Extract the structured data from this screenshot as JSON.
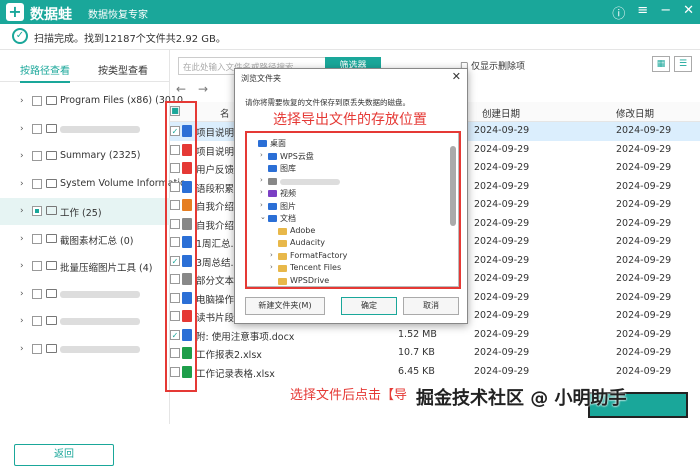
{
  "app": {
    "name": "数据蛙",
    "subtitle": "数据恢复专家"
  },
  "status": {
    "text": "扫描完成。找到12187个文件共2.92 GB。"
  },
  "tabs": [
    "按路径查看",
    "按类型查看"
  ],
  "tree": [
    {
      "label": "Program Files (x86) (3010",
      "blur": false
    },
    {
      "label": "",
      "blur": true
    },
    {
      "label": "Summary (2325)",
      "blur": false
    },
    {
      "label": "System Volume Informatio",
      "blur": false
    },
    {
      "label": "工作 (25)",
      "blur": false,
      "selected": true
    },
    {
      "label": "截图素材汇总 (0)",
      "blur": false
    },
    {
      "label": "批量压缩图片工具 (4)",
      "blur": false
    },
    {
      "label": "",
      "blur": true
    },
    {
      "label": "",
      "blur": true
    },
    {
      "label": "",
      "blur": true
    }
  ],
  "back_label": "返回",
  "toolbar": {
    "search_placeholder": "在此处输入文件名或路径搜索",
    "filter_label": "筛选器",
    "delete_only_label": "仅显示删除项"
  },
  "columns": {
    "name": "名",
    "created": "创建日期",
    "modified": "修改日期"
  },
  "rows": [
    {
      "name": "项目说明书",
      "size": "",
      "created": "2024-09-29",
      "modified": "2024-09-29",
      "checked": true,
      "color": "#2b6fd6",
      "selected": true
    },
    {
      "name": "项目说明书",
      "size": "",
      "created": "2024-09-29",
      "modified": "2024-09-29",
      "checked": false,
      "color": "#e53935"
    },
    {
      "name": "用户反馈数",
      "size": "",
      "created": "2024-09-29",
      "modified": "2024-09-29",
      "checked": false,
      "color": "#e53935"
    },
    {
      "name": "语段积累.do",
      "size": "",
      "created": "2024-09-29",
      "modified": "2024-09-29",
      "checked": false,
      "color": "#2b6fd6"
    },
    {
      "name": "自我介绍.ppt",
      "size": "",
      "created": "2024-09-29",
      "modified": "2024-09-29",
      "checked": false,
      "color": "#e67e22"
    },
    {
      "name": "自我介绍.txt",
      "size": "",
      "created": "2024-09-29",
      "modified": "2024-09-29",
      "checked": false,
      "color": "#888"
    },
    {
      "name": "1周汇总.doc",
      "size": "",
      "created": "2024-09-29",
      "modified": "2024-09-29",
      "checked": false,
      "color": "#2b6fd6"
    },
    {
      "name": "3周总结.doc",
      "size": "",
      "created": "2024-09-29",
      "modified": "2024-09-29",
      "checked": true,
      "color": "#2b6fd6"
    },
    {
      "name": "部分文本框",
      "size": "",
      "created": "2024-09-29",
      "modified": "2024-09-29",
      "checked": false,
      "color": "#888"
    },
    {
      "name": "电脑操作说",
      "size": "",
      "created": "2024-09-29",
      "modified": "2024-09-29",
      "checked": false,
      "color": "#2b6fd6"
    },
    {
      "name": "读书片段记录.pptx",
      "size": "",
      "created": "2024-09-29",
      "modified": "2024-09-29",
      "checked": false,
      "color": "#e53935"
    },
    {
      "name": "附: 使用注意事项.docx",
      "size": "1.52 MB",
      "created": "2024-09-29",
      "modified": "2024-09-29",
      "checked": true,
      "color": "#2b6fd6"
    },
    {
      "name": "工作报表2.xlsx",
      "size": "10.7 KB",
      "created": "2024-09-29",
      "modified": "2024-09-29",
      "checked": false,
      "color": "#1e9e4a"
    },
    {
      "name": "工作记录表格.xlsx",
      "size": "6.45 KB",
      "created": "2024-09-29",
      "modified": "2024-09-29",
      "checked": false,
      "color": "#1e9e4a"
    }
  ],
  "dialog": {
    "title": "浏览文件夹",
    "message": "请你将需要恢复的文件保存到原丢失数据的磁盘。",
    "annotation": "选择导出文件的存放位置",
    "nodes": [
      {
        "label": "桌面",
        "indent": 0,
        "arrow": "",
        "color": "#2b6fd6"
      },
      {
        "label": "WPS云盘",
        "indent": 1,
        "arrow": "›",
        "color": "#2b6fd6"
      },
      {
        "label": "图库",
        "indent": 1,
        "arrow": "",
        "color": "#2b6fd6"
      },
      {
        "label": "",
        "indent": 1,
        "arrow": "›",
        "color": "#888",
        "blur": true
      },
      {
        "label": "视频",
        "indent": 1,
        "arrow": "›",
        "color": "#7b3fc4"
      },
      {
        "label": "图片",
        "indent": 1,
        "arrow": "›",
        "color": "#2b6fd6"
      },
      {
        "label": "文档",
        "indent": 1,
        "arrow": "⌄",
        "color": "#2b6fd6"
      },
      {
        "label": "Adobe",
        "indent": 2,
        "arrow": "",
        "color": "#e8b84a"
      },
      {
        "label": "Audacity",
        "indent": 2,
        "arrow": "",
        "color": "#e8b84a"
      },
      {
        "label": "FormatFactory",
        "indent": 2,
        "arrow": "›",
        "color": "#e8b84a"
      },
      {
        "label": "Tencent Files",
        "indent": 2,
        "arrow": "›",
        "color": "#e8b84a"
      },
      {
        "label": "WPSDrive",
        "indent": 2,
        "arrow": "",
        "color": "#e8b84a"
      }
    ],
    "new_folder_label": "新建文件夹(M)",
    "ok_label": "确定",
    "cancel_label": "取消"
  },
  "bottom_annotation": "选择文件后点击【导",
  "watermark": "掘金技术社区 @ 小明助手"
}
